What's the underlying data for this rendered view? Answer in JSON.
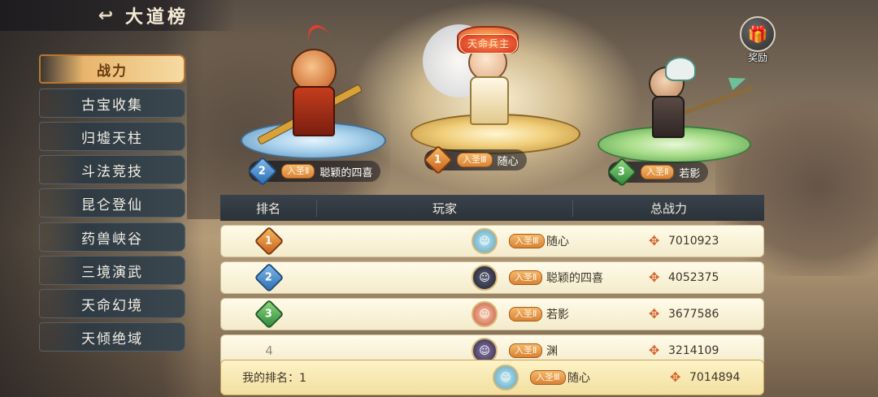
{
  "header": {
    "back_icon": "back-arrow-icon",
    "title": "大道榜"
  },
  "sidebar": {
    "items": [
      {
        "label": "战力",
        "active": true
      },
      {
        "label": "古宝收集"
      },
      {
        "label": "归墟天柱"
      },
      {
        "label": "斗法竞技"
      },
      {
        "label": "昆仑登仙"
      },
      {
        "label": "药兽峡谷"
      },
      {
        "label": "三境演武"
      },
      {
        "label": "天命幻境"
      },
      {
        "label": "天倾绝域"
      }
    ]
  },
  "reward": {
    "label": "奖励",
    "icon": "gift-icon"
  },
  "podium": {
    "first": {
      "rank": "1",
      "realm": "入圣Ⅲ",
      "name": "随心",
      "title_badge": "天命兵主"
    },
    "second": {
      "rank": "2",
      "realm": "入圣Ⅱ",
      "name": "聪颖的四喜"
    },
    "third": {
      "rank": "3",
      "realm": "入圣Ⅱ",
      "name": "若影"
    }
  },
  "table": {
    "headers": {
      "rank": "排名",
      "player": "玩家",
      "power": "总战力"
    },
    "rows": [
      {
        "rank": "1",
        "realm": "入圣Ⅲ",
        "name": "随心",
        "power": "7010923"
      },
      {
        "rank": "2",
        "realm": "入圣Ⅱ",
        "name": "聪颖的四喜",
        "power": "4052375"
      },
      {
        "rank": "3",
        "realm": "入圣Ⅱ",
        "name": "若影",
        "power": "3677586"
      },
      {
        "rank": "4",
        "realm": "入圣Ⅱ",
        "name": "渊",
        "power": "3214109"
      }
    ]
  },
  "my_rank": {
    "label": "我的排名：1",
    "realm": "入圣Ⅲ",
    "name": "随心",
    "power": "7014894"
  },
  "colors": {
    "accent": "#e8b56c",
    "row_bg": "#fffbe8",
    "header_bg": "#2b3339"
  }
}
